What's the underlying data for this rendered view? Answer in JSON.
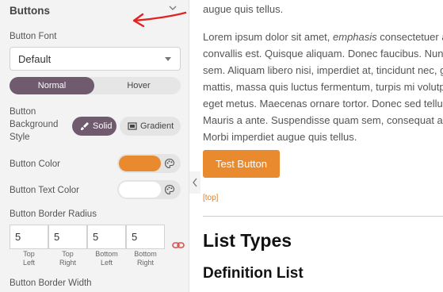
{
  "panel": {
    "title": "Buttons",
    "button_font": {
      "label": "Button Font",
      "value": "Default"
    },
    "state_tabs": [
      {
        "label": "Normal",
        "active": true
      },
      {
        "label": "Hover",
        "active": false
      }
    ],
    "bg_style": {
      "label_lines": [
        "Button",
        "Background",
        "Style"
      ],
      "options": [
        {
          "label": "Solid",
          "active": true
        },
        {
          "label": "Gradient",
          "active": false
        }
      ]
    },
    "button_color": {
      "label": "Button Color",
      "value": "#ea8a2f"
    },
    "button_text_color": {
      "label": "Button Text Color",
      "value": "#ffffff"
    },
    "border_radius": {
      "label": "Button Border Radius",
      "values": [
        {
          "value": "5",
          "caption_lines": [
            "Top",
            "Left"
          ]
        },
        {
          "value": "5",
          "caption_lines": [
            "Top",
            "Right"
          ]
        },
        {
          "value": "5",
          "caption_lines": [
            "Bottom",
            "Left"
          ]
        },
        {
          "value": "5",
          "caption_lines": [
            "Bottom",
            "Right"
          ]
        }
      ]
    },
    "border_width_label": "Button Border Width"
  },
  "content": {
    "p1_lines": [
      "augue quis tellus."
    ],
    "p2": [
      {
        "pre": "Lorem ipsum dolor sit amet, ",
        "em": "emphasis",
        "post": " consectetuer a"
      },
      {
        "pre": "convallis est. Quisque aliquam. Donec faucibus. Nunc"
      },
      {
        "pre": "sem. Aliquam libero nisi, imperdiet at, tincidunt nec, g"
      },
      {
        "pre": "mattis, massa quis luctus fermentum, turpis mi volutpa"
      },
      {
        "pre": "eget metus. Maecenas ornare tortor. Donec sed tellus"
      },
      {
        "pre": "Mauris a ante. Suspendisse quam sem, consequat at, c"
      },
      {
        "pre": "Morbi imperdiet augue quis tellus."
      }
    ],
    "test_button": "Test Button",
    "top_link": "[top]",
    "heading_list_types": "List Types",
    "heading_definition_list": "Definition List"
  },
  "colors": {
    "accent": "#ea8a2f",
    "active_tab": "#6f5a6e",
    "annotation_arrow": "#e02424"
  },
  "icons": [
    "chevron-down-icon",
    "paint-brush-icon",
    "gradient-icon",
    "palette-icon",
    "link-icon",
    "chevron-left-icon",
    "annotation-arrow"
  ]
}
